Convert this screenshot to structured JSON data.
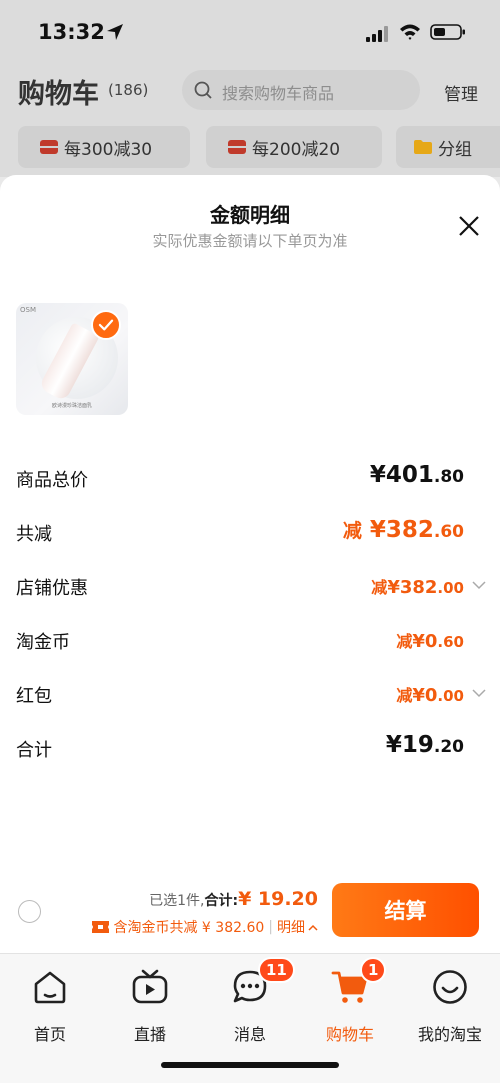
{
  "status_bar": {
    "time": "13:32"
  },
  "cart_header": {
    "title": "购物车",
    "count": "(186)",
    "search_placeholder": "搜索购物车商品",
    "manage_label": "管理",
    "promo_chips": [
      "每300减30",
      "每200减20",
      "分组"
    ]
  },
  "sheet": {
    "title": "金额明细",
    "subtitle": "实际优惠金额请以下单页为准",
    "product": {
      "brand": "OSM",
      "caption": "欧诗漫珍珠洁面乳"
    },
    "rows": [
      {
        "label": "商品总价",
        "prefix": "",
        "main": "¥401",
        "dec": ".80"
      },
      {
        "label": "共减",
        "prefix": "减",
        "main": "¥382",
        "dec": ".60"
      },
      {
        "label": "店铺优惠",
        "prefix": "减",
        "main": "¥382",
        "dec": ".00"
      },
      {
        "label": "淘金币",
        "prefix": "减",
        "main": "¥0",
        "dec": ".60"
      },
      {
        "label": "红包",
        "prefix": "减",
        "main": "¥0",
        "dec": ".00"
      },
      {
        "label": "合计",
        "prefix": "",
        "main": "¥19",
        "dec": ".20"
      }
    ]
  },
  "checkout": {
    "selected_text": "已选1件,",
    "total_label": "合计:",
    "total_amount": "¥ 19.20",
    "discount_text": "含淘金币共减 ¥ 382.60",
    "detail_label": "明细",
    "settle_label": "结算"
  },
  "tab_bar": {
    "tabs": [
      {
        "label": "首页"
      },
      {
        "label": "直播"
      },
      {
        "label": "消息",
        "badge": "11"
      },
      {
        "label": "购物车",
        "badge": "1"
      },
      {
        "label": "我的淘宝"
      }
    ]
  },
  "colors": {
    "accent": "#f25b0e",
    "button": "#ff5a00",
    "badge": "#ff4a1a"
  }
}
